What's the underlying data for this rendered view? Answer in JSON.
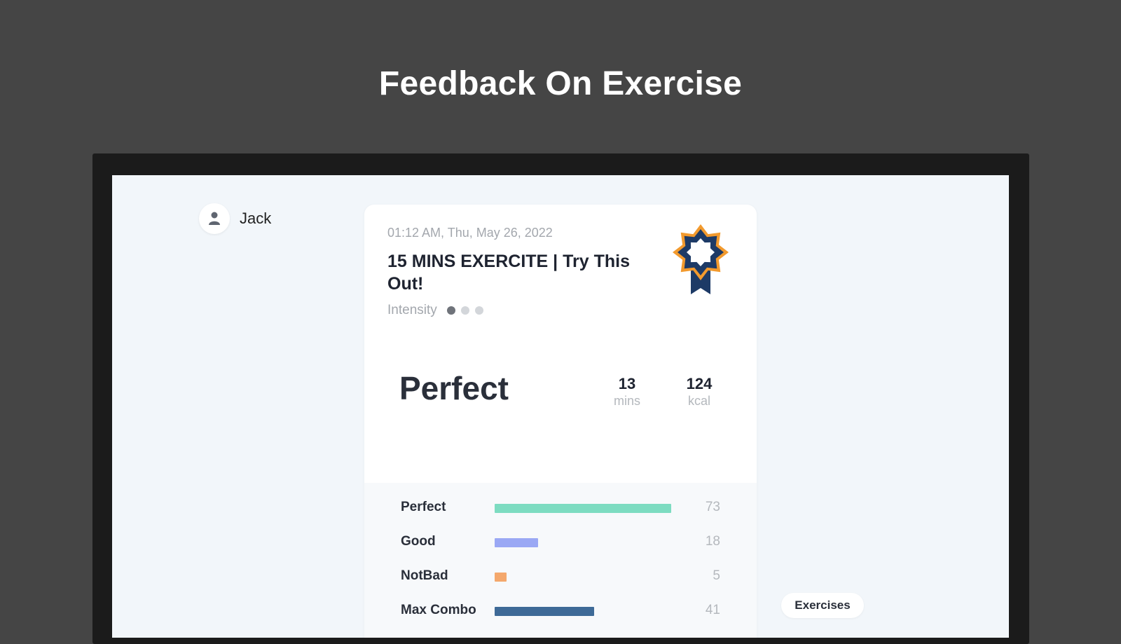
{
  "banner": {
    "title": "Feedback On Exercise"
  },
  "user": {
    "name": "Jack",
    "avatar_icon": "person-icon"
  },
  "workout": {
    "datetime": "01:12 AM, Thu, May 26, 2022",
    "title": "15 MINS EXERCITE | Try This Out!",
    "intensity_label": "Intensity",
    "intensity_level": 1,
    "intensity_max": 3,
    "badge_icon": "award-medal-icon",
    "rating": "Perfect",
    "duration": {
      "value": "13",
      "unit": "mins"
    },
    "calories": {
      "value": "124",
      "unit": "kcal"
    }
  },
  "breakdown": {
    "max_value": 73,
    "rows": [
      {
        "label": "Perfect",
        "value": 73,
        "color": "#7ddcc1"
      },
      {
        "label": "Good",
        "value": 18,
        "color": "#9aa8f4"
      },
      {
        "label": "NotBad",
        "value": 5,
        "color": "#f4a86c"
      },
      {
        "label": "Max Combo",
        "value": 41,
        "color": "#3e6a97"
      }
    ]
  },
  "nav": {
    "exercises_label": "Exercises"
  },
  "colors": {
    "banner_background": "#454545",
    "screen_background": "#f2f6fa",
    "medal_orange": "#f29a2e",
    "medal_navy": "#1d3a66"
  }
}
